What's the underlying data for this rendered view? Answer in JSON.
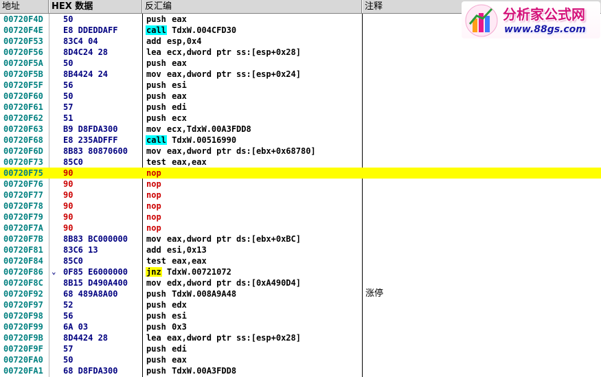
{
  "header": {
    "address": "地址",
    "hex": "HEX 数据",
    "disasm": "反汇编",
    "comment": "注释"
  },
  "watermark": {
    "title": "分析家公式网",
    "url": "www.88gs.com"
  },
  "rows": [
    {
      "addr": "00720F4D",
      "hex": "50",
      "mnemonic": "push",
      "args": " eax"
    },
    {
      "addr": "00720F4E",
      "hex": "E8 DDEDDAFF",
      "mnemonic": "call",
      "args": " TdxW.004CFD30",
      "style": "call"
    },
    {
      "addr": "00720F53",
      "hex": "83C4 04",
      "mnemonic": "add",
      "args": " esp,0x4"
    },
    {
      "addr": "00720F56",
      "hex": "8D4C24 28",
      "mnemonic": "lea",
      "args": " ecx,dword ptr ss:[esp+0x28]"
    },
    {
      "addr": "00720F5A",
      "hex": "50",
      "mnemonic": "push",
      "args": " eax"
    },
    {
      "addr": "00720F5B",
      "hex": "8B4424 24",
      "mnemonic": "mov",
      "args": " eax,dword ptr ss:[esp+0x24]"
    },
    {
      "addr": "00720F5F",
      "hex": "56",
      "mnemonic": "push",
      "args": " esi"
    },
    {
      "addr": "00720F60",
      "hex": "50",
      "mnemonic": "push",
      "args": " eax"
    },
    {
      "addr": "00720F61",
      "hex": "57",
      "mnemonic": "push",
      "args": " edi"
    },
    {
      "addr": "00720F62",
      "hex": "51",
      "mnemonic": "push",
      "args": " ecx"
    },
    {
      "addr": "00720F63",
      "hex": "B9 D8FDA300",
      "mnemonic": "mov",
      "args": " ecx,TdxW.00A3FDD8"
    },
    {
      "addr": "00720F68",
      "hex": "E8 235ADFFF",
      "mnemonic": "call",
      "args": " TdxW.00516990",
      "style": "call"
    },
    {
      "addr": "00720F6D",
      "hex": "8B83 80870600",
      "mnemonic": "mov",
      "args": " eax,dword ptr ds:[ebx+0x68780]"
    },
    {
      "addr": "00720F73",
      "hex": "85C0",
      "mnemonic": "test",
      "args": " eax,eax"
    },
    {
      "addr": "00720F75",
      "hex": "90",
      "mnemonic": "nop",
      "args": "",
      "red": true,
      "selected": true
    },
    {
      "addr": "00720F76",
      "hex": "90",
      "mnemonic": "nop",
      "args": "",
      "red": true
    },
    {
      "addr": "00720F77",
      "hex": "90",
      "mnemonic": "nop",
      "args": "",
      "red": true
    },
    {
      "addr": "00720F78",
      "hex": "90",
      "mnemonic": "nop",
      "args": "",
      "red": true
    },
    {
      "addr": "00720F79",
      "hex": "90",
      "mnemonic": "nop",
      "args": "",
      "red": true
    },
    {
      "addr": "00720F7A",
      "hex": "90",
      "mnemonic": "nop",
      "args": "",
      "red": true
    },
    {
      "addr": "00720F7B",
      "hex": "8B83 BC000000",
      "mnemonic": "mov",
      "args": " eax,dword ptr ds:[ebx+0xBC]"
    },
    {
      "addr": "00720F81",
      "hex": "83C6 13",
      "mnemonic": "add",
      "args": " esi,0x13"
    },
    {
      "addr": "00720F84",
      "hex": "85C0",
      "mnemonic": "test",
      "args": " eax,eax"
    },
    {
      "addr": "00720F86",
      "hex": "0F85 E6000000",
      "mnemonic": "jnz",
      "args": " TdxW.00721072",
      "style": "jnz",
      "marker": "⌄"
    },
    {
      "addr": "00720F8C",
      "hex": "8B15 D490A400",
      "mnemonic": "mov",
      "args": " edx,dword ptr ds:[0xA490D4]"
    },
    {
      "addr": "00720F92",
      "hex": "68 489A8A00",
      "mnemonic": "push",
      "args": " TdxW.008A9A48",
      "comment": "涨停"
    },
    {
      "addr": "00720F97",
      "hex": "52",
      "mnemonic": "push",
      "args": " edx"
    },
    {
      "addr": "00720F98",
      "hex": "56",
      "mnemonic": "push",
      "args": " esi"
    },
    {
      "addr": "00720F99",
      "hex": "6A 03",
      "mnemonic": "push",
      "args": " 0x3"
    },
    {
      "addr": "00720F9B",
      "hex": "8D4424 28",
      "mnemonic": "lea",
      "args": " eax,dword ptr ss:[esp+0x28]"
    },
    {
      "addr": "00720F9F",
      "hex": "57",
      "mnemonic": "push",
      "args": " edi"
    },
    {
      "addr": "00720FA0",
      "hex": "50",
      "mnemonic": "push",
      "args": " eax"
    },
    {
      "addr": "00720FA1",
      "hex": "68 D8FDA300",
      "mnemonic": "push",
      "args": " TdxW.00A3FDD8"
    }
  ]
}
